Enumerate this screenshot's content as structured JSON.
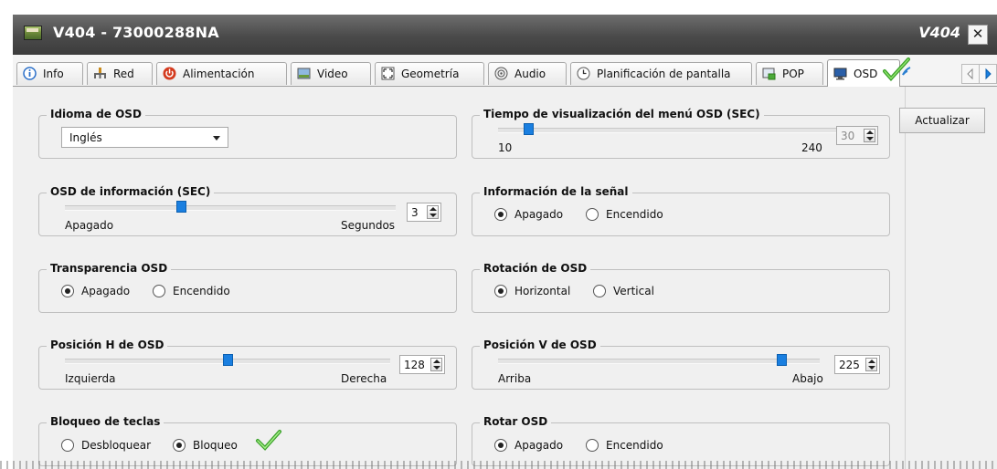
{
  "window": {
    "title": "V404 - 73000288NA",
    "model": "V404",
    "close": "✕"
  },
  "tabs": [
    {
      "label": "Info",
      "icon": "info-icon"
    },
    {
      "label": "Red",
      "icon": "network-icon"
    },
    {
      "label": "Alimentación",
      "icon": "power-icon"
    },
    {
      "label": "Video",
      "icon": "video-icon"
    },
    {
      "label": "Geometría",
      "icon": "geometry-icon"
    },
    {
      "label": "Audio",
      "icon": "audio-icon"
    },
    {
      "label": "Planificación de pantalla",
      "icon": "schedule-icon"
    },
    {
      "label": "POP",
      "icon": "pop-icon"
    },
    {
      "label": "OSD",
      "icon": "monitor-icon",
      "active": true
    }
  ],
  "actualizar": "Actualizar",
  "idioma": {
    "title": "Idioma de OSD",
    "value": "Inglés"
  },
  "tiempo": {
    "title": "Tiempo de visualización del menú OSD (SEC)",
    "min": "10",
    "max": "240",
    "value": "30",
    "fraction": 0.09
  },
  "info_osd": {
    "title": "OSD de información (SEC)",
    "left": "Apagado",
    "right": "Segundos",
    "value": "3",
    "fraction": 0.35
  },
  "senal": {
    "title": "Información de la señal",
    "opt1": "Apagado",
    "opt2": "Encendido",
    "selected": "Apagado"
  },
  "transparencia": {
    "title": "Transparencia OSD",
    "opt1": "Apagado",
    "opt2": "Encendido",
    "selected": "Apagado"
  },
  "rotacion": {
    "title": "Rotación de OSD",
    "opt1": "Horizontal",
    "opt2": "Vertical",
    "selected": "Horizontal"
  },
  "pos_h": {
    "title": "Posición H de OSD",
    "left": "Izquierda",
    "right": "Derecha",
    "value": "128",
    "fraction": 0.5
  },
  "pos_v": {
    "title": "Posición V de OSD",
    "left": "Arriba",
    "right": "Abajo",
    "value": "225",
    "fraction": 0.88
  },
  "bloqueo": {
    "title": "Bloqueo de teclas",
    "opt1": "Desbloquear",
    "opt2": "Bloqueo",
    "selected": "Bloqueo"
  },
  "rotar": {
    "title": "Rotar OSD",
    "opt1": "Apagado",
    "opt2": "Encendido",
    "selected": "Apagado"
  },
  "colors": {
    "accent": "#1a7fe0",
    "check": "#5cc23a",
    "titlebar": "#4a4a4a"
  }
}
